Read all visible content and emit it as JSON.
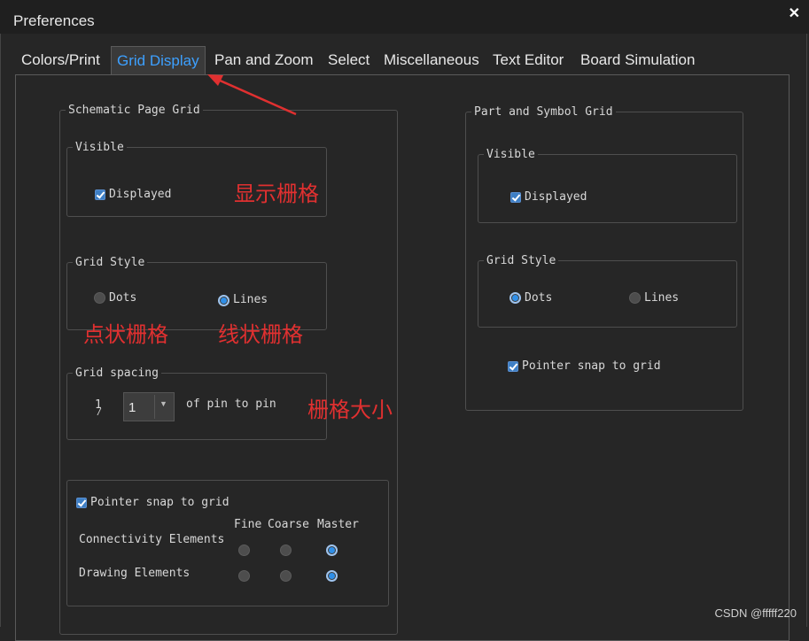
{
  "window": {
    "title": "Preferences"
  },
  "tabs": [
    {
      "label": "Colors/Print"
    },
    {
      "label": "Grid Display"
    },
    {
      "label": "Pan and Zoom"
    },
    {
      "label": "Select"
    },
    {
      "label": "Miscellaneous"
    },
    {
      "label": "Text Editor"
    },
    {
      "label": "Board Simulation"
    }
  ],
  "active_tab": "Grid Display",
  "schematic": {
    "title": "Schematic Page Grid",
    "visible": {
      "legend": "Visible",
      "displayed_label": "Displayed",
      "displayed": true
    },
    "style": {
      "legend": "Grid Style",
      "dots_label": "Dots",
      "lines_label": "Lines",
      "selected": "Lines"
    },
    "spacing": {
      "legend": "Grid spacing",
      "fraction_num": "1",
      "fraction_den": "/",
      "value": "1",
      "suffix": "of pin to pin"
    },
    "snap": {
      "label": "Pointer snap to grid",
      "checked": true,
      "columns": [
        "Fine",
        "Coarse",
        "Master"
      ],
      "rows": [
        {
          "label": "Connectivity Elements",
          "selected": "Master"
        },
        {
          "label": "Drawing Elements",
          "selected": "Master"
        }
      ]
    }
  },
  "part_symbol": {
    "title": "Part and Symbol Grid",
    "visible": {
      "legend": "Visible",
      "displayed_label": "Displayed",
      "displayed": true
    },
    "style": {
      "legend": "Grid Style",
      "dots_label": "Dots",
      "lines_label": "Lines",
      "selected": "Dots"
    },
    "snap": {
      "label": "Pointer snap to grid",
      "checked": true
    }
  },
  "annotations": {
    "display_grid": "显示栅格",
    "dot_grid": "点状栅格",
    "line_grid": "线状栅格",
    "grid_size": "栅格大小",
    "color": "#e03030"
  },
  "watermark": "CSDN @fffff220",
  "colors": {
    "accent": "#3da0ff",
    "background": "#262626",
    "annotation": "#e03030"
  }
}
